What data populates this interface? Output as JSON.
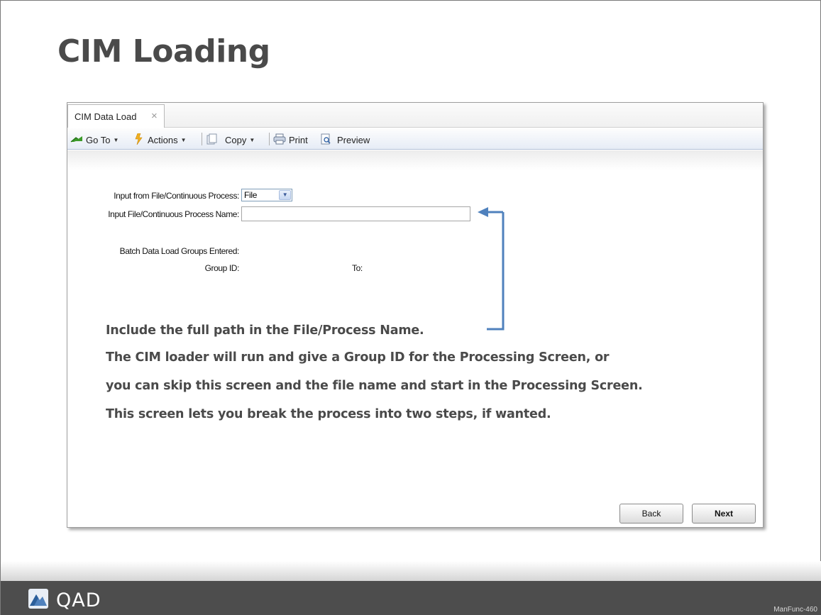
{
  "slide": {
    "title": "CIM Loading",
    "code": "ManFunc-460"
  },
  "window": {
    "tab_label": "CIM Data Load",
    "tab_close": "×",
    "toolbar": {
      "goto": "Go To",
      "actions": "Actions",
      "copy": "Copy",
      "print": "Print",
      "preview": "Preview"
    },
    "form": {
      "input_from_label": "Input from File/Continuous Process:",
      "input_from_value": "File",
      "input_name_label": "Input File/Continuous Process Name:",
      "input_name_value": "",
      "batch_groups_label": "Batch Data Load Groups Entered:",
      "group_id_label": "Group ID:",
      "to_label": "To:"
    },
    "buttons": {
      "back": "Back",
      "next": "Next"
    }
  },
  "annotations": [
    "Include the full path in the File/Process Name.",
    "The CIM loader will run and give a Group ID for the Processing Screen, or",
    "you can skip this screen and the file name and start in the Processing Screen.",
    "This screen lets you break the process into two steps, if wanted."
  ],
  "annotation_arrow_color": "#4f81bd",
  "footer": {
    "logo_text": "QAD",
    "background": "#4d4d4d"
  },
  "icons": {
    "goto": "goto-arrow-icon",
    "actions": "actions-lightning-icon",
    "copy": "copy-icon",
    "print": "printer-icon",
    "preview": "preview-icon",
    "logo": "qad-logo-icon"
  }
}
